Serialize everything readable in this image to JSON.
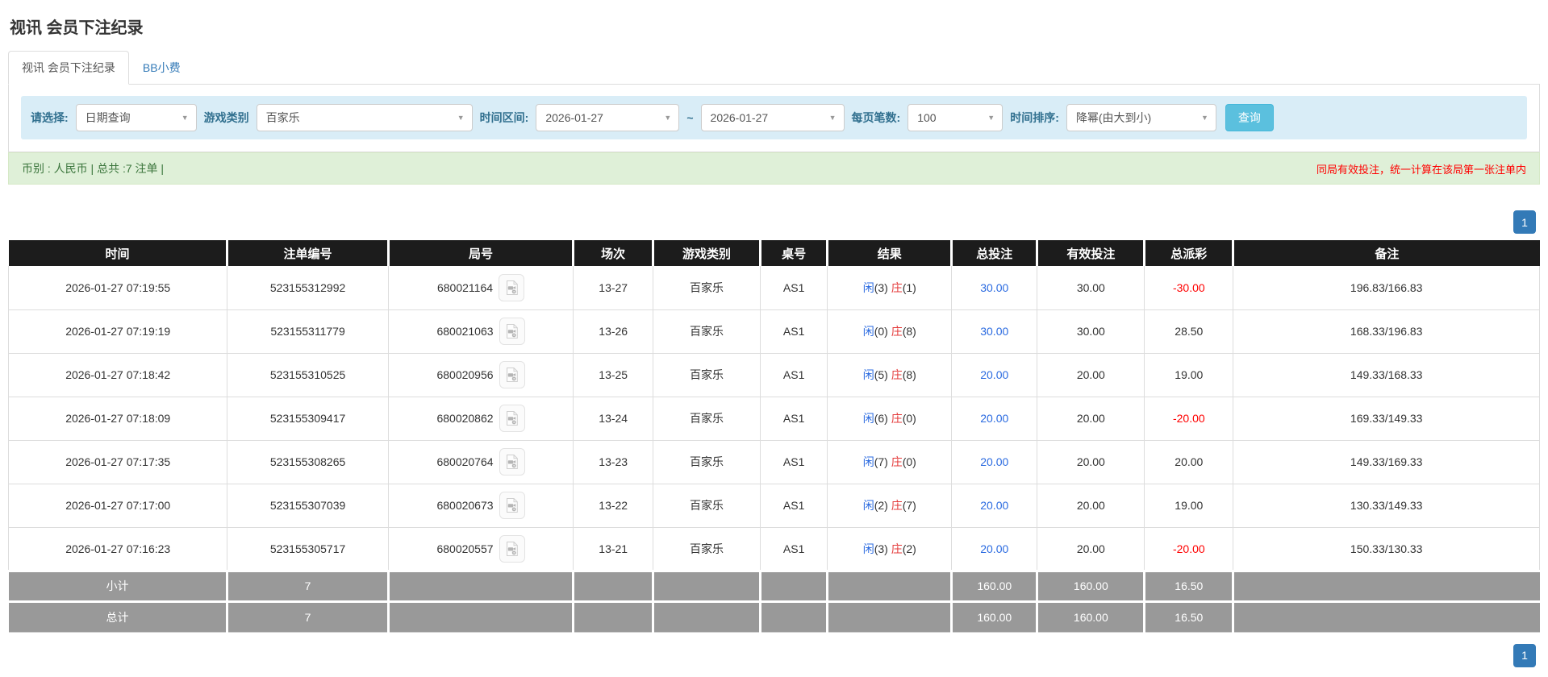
{
  "page": {
    "title": "视讯 会员下注纪录"
  },
  "tabs": [
    {
      "label": "视讯 会员下注纪录",
      "active": true
    },
    {
      "label": "BB小费",
      "active": false
    }
  ],
  "filters": {
    "select_label": "请选择:",
    "query_type": "日期查询",
    "game_label": "游戏类别",
    "game_type": "百家乐",
    "range_label": "时间区间:",
    "date_from": "2026-01-27",
    "range_tilde": "~",
    "date_to": "2026-01-27",
    "per_page_label": "每页笔数:",
    "per_page": "100",
    "sort_label": "时间排序:",
    "sort_order": "降幂(由大到小)",
    "query_button": "查询"
  },
  "summary": {
    "info": "币别 : 人民币 | 总共 :7 注单 |",
    "note": "同局有效投注，统一计算在该局第一张注单内"
  },
  "pagination": {
    "page": "1"
  },
  "table": {
    "columns": [
      "时间",
      "注单编号",
      "局号",
      "场次",
      "游戏类别",
      "桌号",
      "结果",
      "总投注",
      "有效投注",
      "总派彩",
      "备注"
    ],
    "rows": [
      {
        "time": "2026-01-27 07:19:55",
        "bet_id": "523155312992",
        "round_id": "680021164",
        "session": "13-27",
        "game": "百家乐",
        "table": "AS1",
        "player_label": "闲",
        "player_score": "(3)",
        "banker_label": "庄",
        "banker_score": "(1)",
        "total_bet": "30.00",
        "valid_bet": "30.00",
        "payout": "-30.00",
        "remark": "196.83/166.83"
      },
      {
        "time": "2026-01-27 07:19:19",
        "bet_id": "523155311779",
        "round_id": "680021063",
        "session": "13-26",
        "game": "百家乐",
        "table": "AS1",
        "player_label": "闲",
        "player_score": "(0)",
        "banker_label": "庄",
        "banker_score": "(8)",
        "total_bet": "30.00",
        "valid_bet": "30.00",
        "payout": "28.50",
        "remark": "168.33/196.83"
      },
      {
        "time": "2026-01-27 07:18:42",
        "bet_id": "523155310525",
        "round_id": "680020956",
        "session": "13-25",
        "game": "百家乐",
        "table": "AS1",
        "player_label": "闲",
        "player_score": "(5)",
        "banker_label": "庄",
        "banker_score": "(8)",
        "total_bet": "20.00",
        "valid_bet": "20.00",
        "payout": "19.00",
        "remark": "149.33/168.33"
      },
      {
        "time": "2026-01-27 07:18:09",
        "bet_id": "523155309417",
        "round_id": "680020862",
        "session": "13-24",
        "game": "百家乐",
        "table": "AS1",
        "player_label": "闲",
        "player_score": "(6)",
        "banker_label": "庄",
        "banker_score": "(0)",
        "total_bet": "20.00",
        "valid_bet": "20.00",
        "payout": "-20.00",
        "remark": "169.33/149.33"
      },
      {
        "time": "2026-01-27 07:17:35",
        "bet_id": "523155308265",
        "round_id": "680020764",
        "session": "13-23",
        "game": "百家乐",
        "table": "AS1",
        "player_label": "闲",
        "player_score": "(7)",
        "banker_label": "庄",
        "banker_score": "(0)",
        "total_bet": "20.00",
        "valid_bet": "20.00",
        "payout": "20.00",
        "remark": "149.33/169.33"
      },
      {
        "time": "2026-01-27 07:17:00",
        "bet_id": "523155307039",
        "round_id": "680020673",
        "session": "13-22",
        "game": "百家乐",
        "table": "AS1",
        "player_label": "闲",
        "player_score": "(2)",
        "banker_label": "庄",
        "banker_score": "(7)",
        "total_bet": "20.00",
        "valid_bet": "20.00",
        "payout": "19.00",
        "remark": "130.33/149.33"
      },
      {
        "time": "2026-01-27 07:16:23",
        "bet_id": "523155305717",
        "round_id": "680020557",
        "session": "13-21",
        "game": "百家乐",
        "table": "AS1",
        "player_label": "闲",
        "player_score": "(3)",
        "banker_label": "庄",
        "banker_score": "(2)",
        "total_bet": "20.00",
        "valid_bet": "20.00",
        "payout": "-20.00",
        "remark": "150.33/130.33"
      }
    ],
    "footer": [
      {
        "label": "小计",
        "count": "7",
        "total_bet": "160.00",
        "valid_bet": "160.00",
        "payout": "16.50"
      },
      {
        "label": "总计",
        "count": "7",
        "total_bet": "160.00",
        "valid_bet": "160.00",
        "payout": "16.50"
      }
    ]
  },
  "icons": {
    "round_record": "video-record-icon",
    "select_caret": "chevron-down-icon"
  },
  "colors": {
    "header_bg": "#1c1c1c",
    "footer_bg": "#999999",
    "filter_bg": "#d9edf7",
    "summary_bg": "#dff0d8",
    "accent_button": "#5bc0de",
    "pagination_active": "#337ab7",
    "link_blue": "#2a6ae0",
    "negative_red": "#ff0000",
    "banker_red": "#e43b3b",
    "summary_note_red": "#ff0000"
  }
}
